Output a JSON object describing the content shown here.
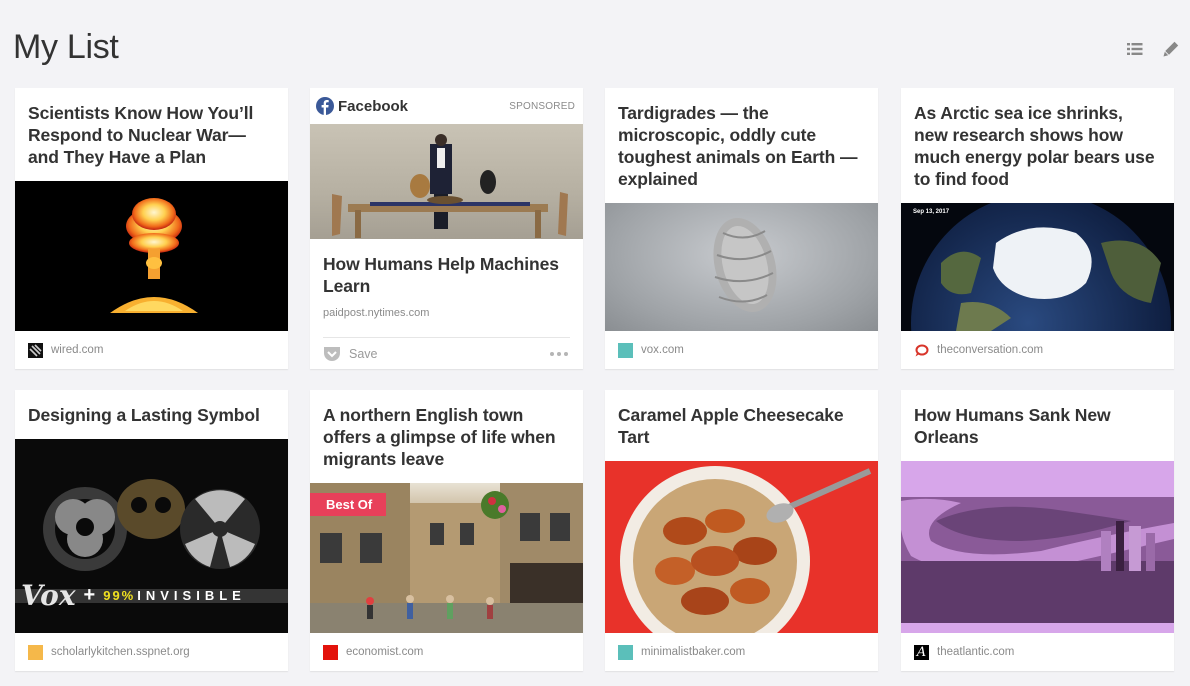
{
  "header": {
    "title": "My List",
    "list_view_icon": "list-icon",
    "edit_icon": "pencil-icon"
  },
  "cards": [
    {
      "title": "Scientists Know How You’ll Respond to Nuclear War—and They Have a Plan",
      "domain": "wired.com",
      "favicon": "wired-favicon",
      "image": "pixel-mushroom-cloud"
    },
    {
      "sponsored": true,
      "brand": "Facebook",
      "brand_icon": "facebook-icon",
      "brand_color": "#3b5998",
      "sponsored_label": "SPONSORED",
      "title": "How Humans Help Machines Learn",
      "domain": "paidpost.nytimes.com",
      "save_label": "Save",
      "save_icon": "pocket-save-icon",
      "more_icon": "more-dots-icon",
      "image": "woman-with-dogs-at-table"
    },
    {
      "title": "Tardigrades — the microscopic, oddly cute toughest animals on Earth — explained",
      "domain": "vox.com",
      "favicon": "vox-favicon",
      "favicon_color": "#5bbfba",
      "image": "tardigrade-micrograph"
    },
    {
      "title": "As Arctic sea ice shrinks, new research shows how much energy polar bears use to find food",
      "domain": "theconversation.com",
      "favicon": "theconversation-favicon",
      "favicon_color": "#d8352a",
      "image": "arctic-globe",
      "image_caption": "Sep 13, 2017"
    },
    {
      "title": "Designing a Lasting Symbol",
      "domain": "scholarlykitchen.sspnet.org",
      "favicon": "scholarlykitchen-favicon",
      "favicon_color": "#f5b84a",
      "image": "vox-99-invisible-hazard-symbols",
      "image_text": {
        "brand": "Vox",
        "plus": "+",
        "percent": "99%",
        "word": "INVISIBLE"
      }
    },
    {
      "title": "A northern English town offers a glimpse of life when migrants leave",
      "domain": "economist.com",
      "favicon": "economist-favicon",
      "favicon_color": "#e3120b",
      "badge": "Best Of",
      "badge_color": "#e8405a",
      "image": "english-town-street"
    },
    {
      "title": "Caramel Apple Cheesecake Tart",
      "domain": "minimalistbaker.com",
      "favicon": "minimalistbaker-favicon",
      "favicon_color": "#5bbfba",
      "image": "caramel-apple-tart"
    },
    {
      "title": "How Humans Sank New Orleans",
      "domain": "theatlantic.com",
      "favicon": "theatlantic-favicon",
      "favicon_letter": "A",
      "image": "new-orleans-aerial-purple"
    }
  ]
}
